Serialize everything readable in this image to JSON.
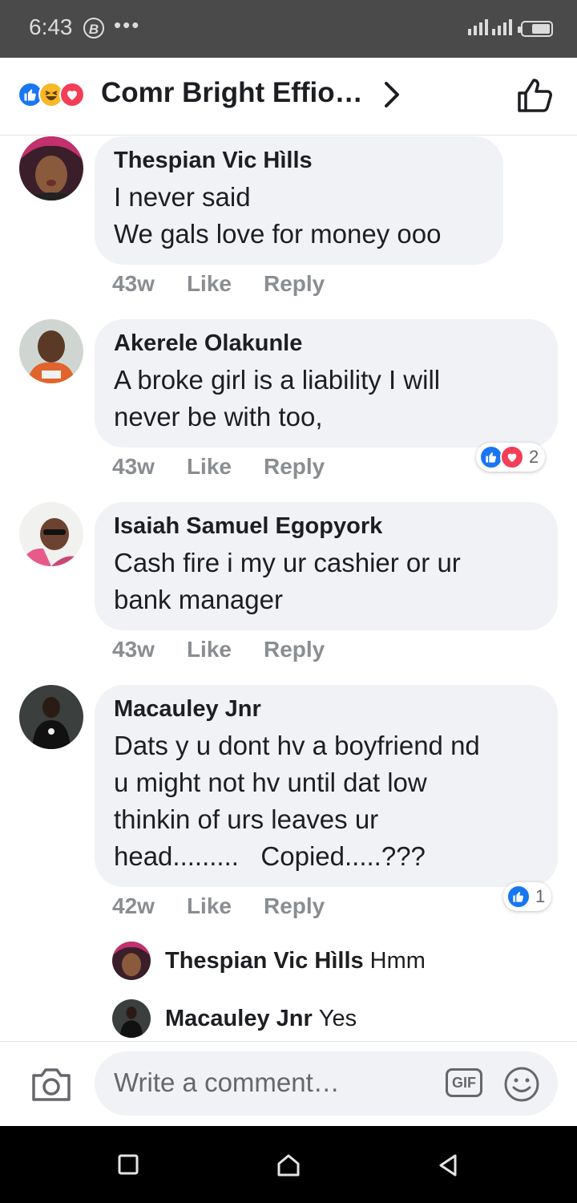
{
  "status_bar": {
    "time": "6:43",
    "b_badge": "B",
    "dots": "•••"
  },
  "header": {
    "title": "Comr Bright Effio…"
  },
  "comments": [
    {
      "name": "Thespian Vic Hìlls",
      "text": "I never said\nWe gals love for money ooo",
      "age": "43w",
      "like": "Like",
      "reply": "Reply",
      "reaction_count": ""
    },
    {
      "name": "Akerele Olakunle",
      "text": "A broke girl is a liability I will\nnever be with too,",
      "age": "43w",
      "like": "Like",
      "reply": "Reply",
      "reaction_count": "2"
    },
    {
      "name": "Isaiah Samuel Egopyork",
      "text": "Cash fire i my ur cashier or ur\nbank manager",
      "age": "43w",
      "like": "Like",
      "reply": "Reply",
      "reaction_count": ""
    },
    {
      "name": "Macauley Jnr",
      "text": "Dats y u dont hv a boyfriend nd\nu might not hv until dat low\nthinkin of urs leaves ur\nhead.........   Copied.....???",
      "age": "42w",
      "like": "Like",
      "reply": "Reply",
      "reaction_count": "1"
    }
  ],
  "replies": [
    {
      "name": "Thespian Vic Hìlls",
      "text": "Hmm"
    },
    {
      "name": "Macauley Jnr",
      "text": "Yes"
    }
  ],
  "composer": {
    "placeholder": "Write a comment…",
    "gif_label": "GIF"
  },
  "colors": {
    "like_blue": "#1877f2",
    "love_red": "#f33e58",
    "haha_yellow": "#f7b928",
    "bubble_bg": "#f0f2f5",
    "meta_gray": "#8a8d91"
  }
}
